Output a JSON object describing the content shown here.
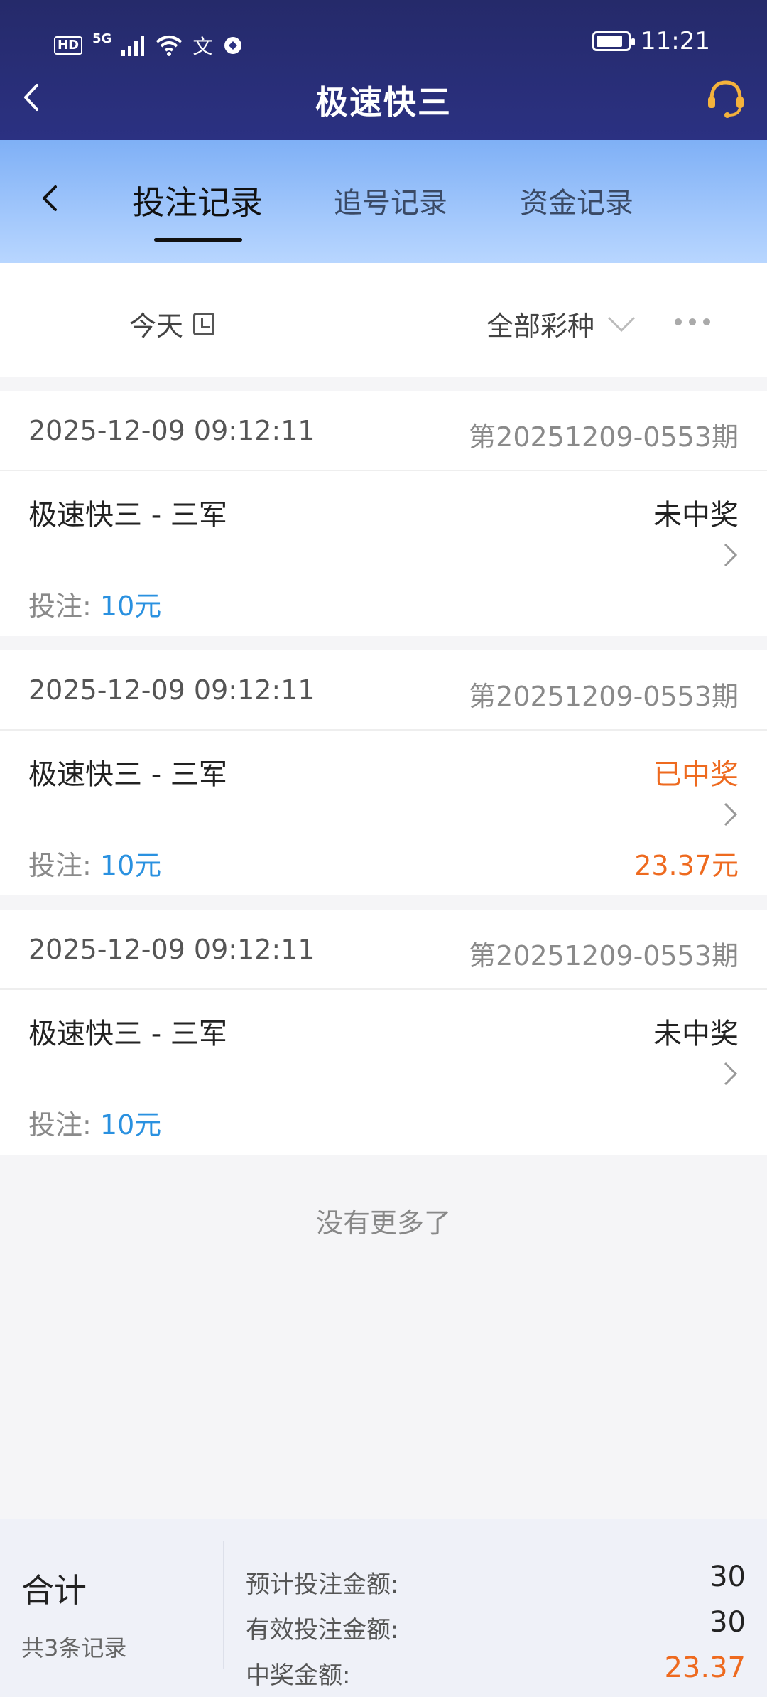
{
  "status_bar": {
    "hd": "HD",
    "network": "5G",
    "time": "11:21"
  },
  "header": {
    "title": "极速快三"
  },
  "tabs": [
    {
      "label": "投注记录",
      "active": true
    },
    {
      "label": "追号记录",
      "active": false
    },
    {
      "label": "资金记录",
      "active": false
    }
  ],
  "filter": {
    "date_label": "今天",
    "type_label": "全部彩种"
  },
  "records": [
    {
      "time": "2025-12-09 09:12:11",
      "issue": "第20251209-0553期",
      "name": "极速快三 - 三军",
      "status": "未中奖",
      "bet_label": "投注:",
      "bet_amount": "10元",
      "prize": ""
    },
    {
      "time": "2025-12-09 09:12:11",
      "issue": "第20251209-0553期",
      "name": "极速快三 - 三军",
      "status": "已中奖",
      "bet_label": "投注:",
      "bet_amount": "10元",
      "prize": "23.37元"
    },
    {
      "time": "2025-12-09 09:12:11",
      "issue": "第20251209-0553期",
      "name": "极速快三 - 三军",
      "status": "未中奖",
      "bet_label": "投注:",
      "bet_amount": "10元",
      "prize": ""
    }
  ],
  "no_more": "没有更多了",
  "summary": {
    "title": "合计",
    "count": "共3条记录",
    "rows": [
      {
        "label": "预计投注金额:",
        "value": "30"
      },
      {
        "label": "有效投注金额:",
        "value": "30"
      },
      {
        "label": "中奖金额:",
        "value": "23.37"
      }
    ]
  },
  "colors": {
    "header_bg": "#2b3182",
    "accent_orange": "#ee6a1f",
    "accent_blue": "#2a91e0"
  }
}
